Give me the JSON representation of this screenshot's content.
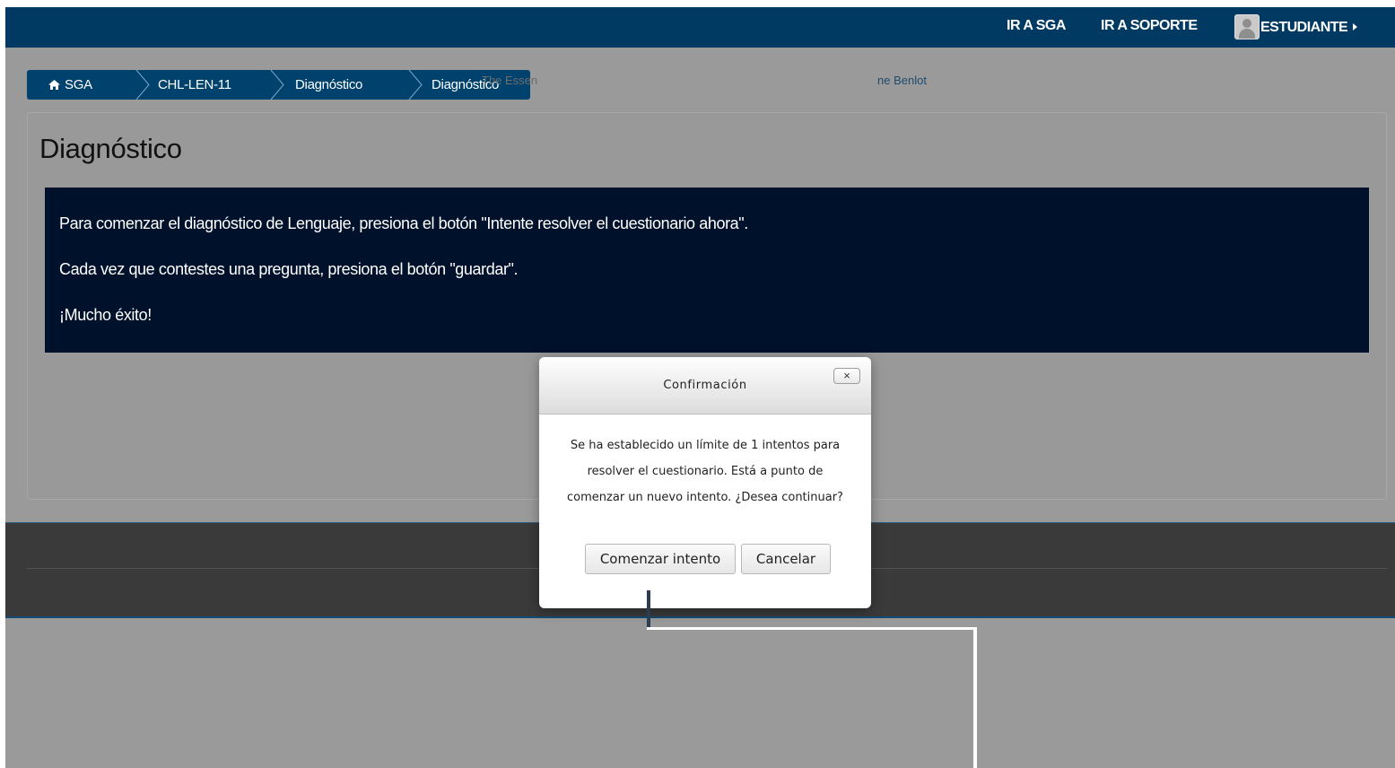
{
  "navbar": {
    "links": [
      "IR A SGA",
      "IR A SOPORTE"
    ],
    "user_label": "ESTUDIANTE",
    "color": "#003a63"
  },
  "breadcrumb": {
    "items": [
      "SGA",
      "CHL-LEN-11",
      "Diagnóstico",
      "Diagnóstico"
    ],
    "color": "#00426e"
  },
  "page": {
    "title": "Diagnóstico"
  },
  "info": {
    "lines": [
      "Para comenzar el diagnóstico de Lenguaje, presiona el botón \"Intente resolver el cuestionario ahora\".",
      "Cada vez que contestes una pregunta, presiona el botón \"guardar\".",
      "¡Mucho éxito!"
    ],
    "color": "#00112b"
  },
  "footer": {
    "text_partial": "The Essen",
    "link_partial": "ne Benlot"
  },
  "dialog": {
    "title": "Confirmación",
    "close_label": "×",
    "message": "Se ha establecido un límite de 1 intentos para resolver el cuestionario. Está a punto de comenzar un nuevo intento. ¿Desea continuar?",
    "buttons": {
      "start": "Comenzar intento",
      "cancel": "Cancelar"
    }
  },
  "overlay_color": "#9a9a9a"
}
